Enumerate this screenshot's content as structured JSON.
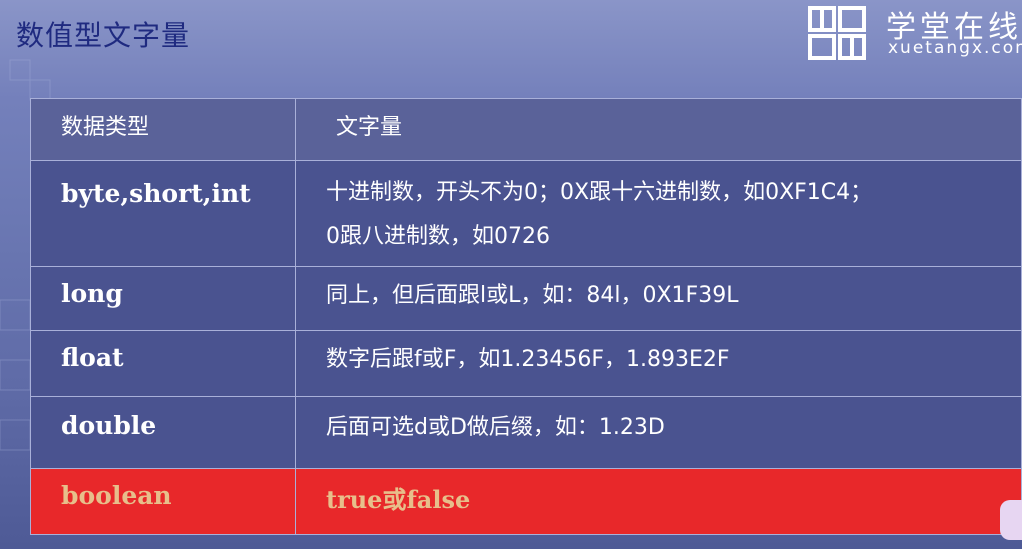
{
  "slide": {
    "title": "数值型文字量",
    "logo": {
      "cn": "学堂在线",
      "en": "xuetangx.com"
    }
  },
  "table": {
    "headers": [
      "数据类型",
      "文字量"
    ],
    "rows": [
      {
        "type": "byte,short,int",
        "desc_lines": [
          "十进制数，开头不为0；0X跟十六进制数，如0XF1C4；",
          "0跟八进制数，如0726"
        ]
      },
      {
        "type": "long",
        "desc_lines": [
          "同上，但后面跟l或L，如：84l，0X1F39L"
        ]
      },
      {
        "type": "float",
        "desc_lines": [
          "数字后跟f或F，如1.23456F，1.893E2F"
        ]
      },
      {
        "type": "double",
        "desc_lines": [
          "后面可选d或D做后缀，如：1.23D"
        ]
      },
      {
        "type": "boolean",
        "desc_lines": [
          "true或false"
        ],
        "highlighted": true
      }
    ]
  },
  "colors": {
    "highlight_row": "#e8282a",
    "highlight_text": "#e7bf8b",
    "title": "#1f2a80"
  }
}
